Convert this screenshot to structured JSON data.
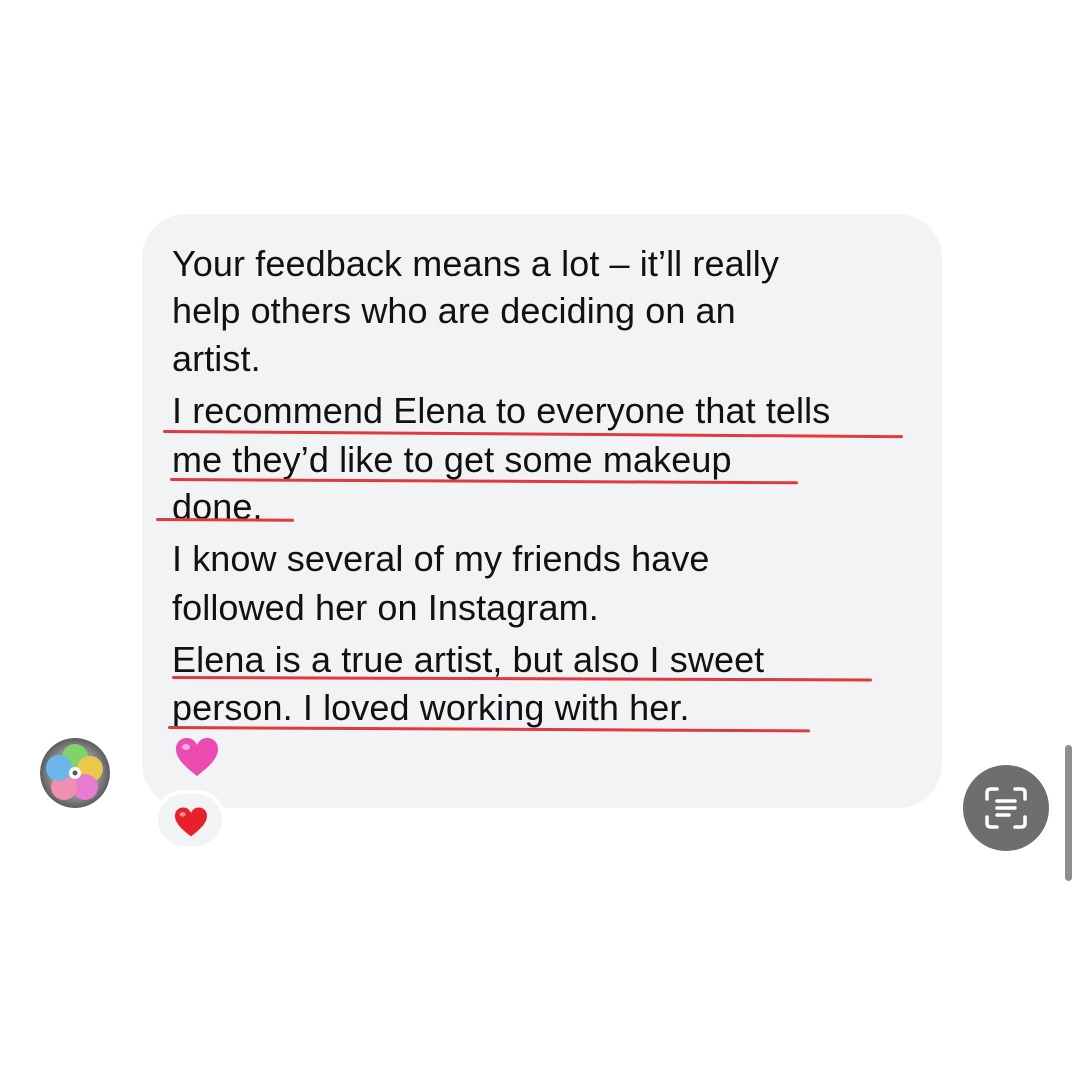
{
  "message": {
    "lines": [
      "Your feedback means a lot – it’ll really",
      "help others who are deciding on an",
      "artist.",
      "I recommend Elena to everyone that tells",
      "me they’d like to get some makeup",
      "done.",
      "I know several of my friends have",
      "followed her on Instagram.",
      "Elena is a true artist, but also I sweet",
      "person. I loved working with her."
    ],
    "emoji": "pink-heart",
    "reaction": "red-heart"
  },
  "colors": {
    "bubble": "#f2f3f5",
    "text": "#111111",
    "underline": "#e0393e",
    "pink_heart": "#ec4bb0",
    "red_heart": "#e8202a",
    "scan_button": "#6e6e6e"
  },
  "icons": {
    "avatar": "avatar-flower-image",
    "scan": "scan-text-icon"
  }
}
